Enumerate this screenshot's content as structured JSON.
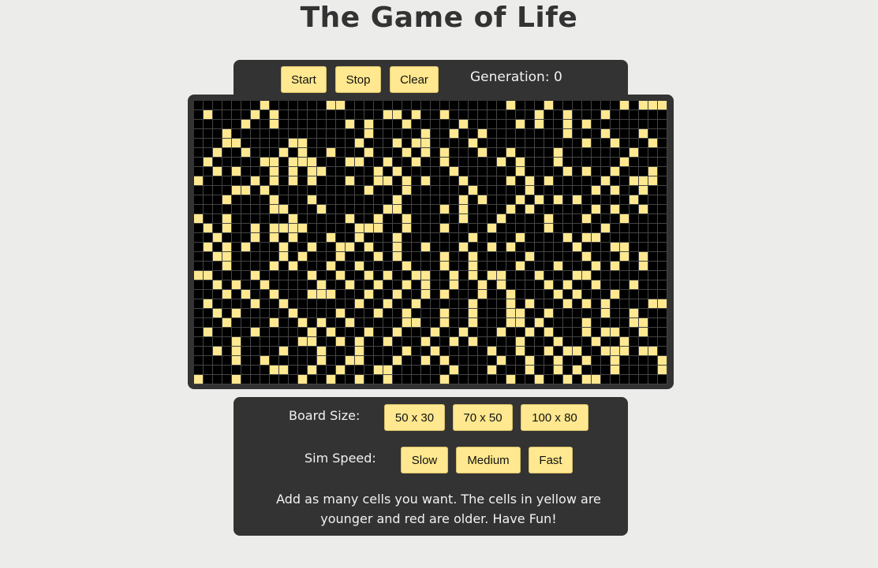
{
  "page": {
    "title": "The Game of Life"
  },
  "controls": {
    "start_label": "Start",
    "stop_label": "Stop",
    "clear_label": "Clear",
    "generation_text": "Generation: 0"
  },
  "board": {
    "columns": 50,
    "rows": 30,
    "alive_color": "#ffe88f",
    "dead_color": "#000000",
    "alive_cells": [
      [
        0,
        7
      ],
      [
        0,
        14
      ],
      [
        0,
        15
      ],
      [
        0,
        33
      ],
      [
        0,
        37
      ],
      [
        0,
        45
      ],
      [
        0,
        47
      ],
      [
        0,
        48
      ],
      [
        0,
        49
      ],
      [
        1,
        1
      ],
      [
        1,
        6
      ],
      [
        1,
        8
      ],
      [
        1,
        20
      ],
      [
        1,
        21
      ],
      [
        1,
        23
      ],
      [
        1,
        26
      ],
      [
        1,
        36
      ],
      [
        1,
        39
      ],
      [
        1,
        43
      ],
      [
        2,
        5
      ],
      [
        2,
        8
      ],
      [
        2,
        16
      ],
      [
        2,
        18
      ],
      [
        2,
        22
      ],
      [
        2,
        28
      ],
      [
        2,
        34
      ],
      [
        2,
        36
      ],
      [
        2,
        39
      ],
      [
        2,
        41
      ],
      [
        3,
        3
      ],
      [
        3,
        18
      ],
      [
        3,
        24
      ],
      [
        3,
        27
      ],
      [
        3,
        30
      ],
      [
        3,
        39
      ],
      [
        3,
        43
      ],
      [
        3,
        47
      ],
      [
        4,
        3
      ],
      [
        4,
        4
      ],
      [
        4,
        10
      ],
      [
        4,
        11
      ],
      [
        4,
        17
      ],
      [
        4,
        21
      ],
      [
        4,
        23
      ],
      [
        4,
        24
      ],
      [
        4,
        29
      ],
      [
        4,
        41
      ],
      [
        4,
        44
      ],
      [
        4,
        48
      ],
      [
        5,
        2
      ],
      [
        5,
        5
      ],
      [
        5,
        9
      ],
      [
        5,
        11
      ],
      [
        5,
        14
      ],
      [
        5,
        18
      ],
      [
        5,
        22
      ],
      [
        5,
        24
      ],
      [
        5,
        26
      ],
      [
        5,
        30
      ],
      [
        5,
        33
      ],
      [
        5,
        38
      ],
      [
        5,
        46
      ],
      [
        6,
        1
      ],
      [
        6,
        7
      ],
      [
        6,
        8
      ],
      [
        6,
        10
      ],
      [
        6,
        11
      ],
      [
        6,
        12
      ],
      [
        6,
        16
      ],
      [
        6,
        17
      ],
      [
        6,
        20
      ],
      [
        6,
        23
      ],
      [
        6,
        26
      ],
      [
        6,
        32
      ],
      [
        6,
        34
      ],
      [
        6,
        38
      ],
      [
        6,
        45
      ],
      [
        7,
        2
      ],
      [
        7,
        4
      ],
      [
        7,
        8
      ],
      [
        7,
        10
      ],
      [
        7,
        12
      ],
      [
        7,
        13
      ],
      [
        7,
        19
      ],
      [
        7,
        21
      ],
      [
        7,
        27
      ],
      [
        7,
        34
      ],
      [
        7,
        39
      ],
      [
        7,
        41
      ],
      [
        7,
        44
      ],
      [
        7,
        48
      ],
      [
        8,
        0
      ],
      [
        8,
        6
      ],
      [
        8,
        8
      ],
      [
        8,
        10
      ],
      [
        8,
        12
      ],
      [
        8,
        16
      ],
      [
        8,
        19
      ],
      [
        8,
        20
      ],
      [
        8,
        22
      ],
      [
        8,
        24
      ],
      [
        8,
        28
      ],
      [
        8,
        33
      ],
      [
        8,
        35
      ],
      [
        8,
        37
      ],
      [
        8,
        43
      ],
      [
        8,
        46
      ],
      [
        8,
        47
      ],
      [
        8,
        48
      ],
      [
        9,
        4
      ],
      [
        9,
        5
      ],
      [
        9,
        7
      ],
      [
        9,
        18
      ],
      [
        9,
        22
      ],
      [
        9,
        29
      ],
      [
        9,
        35
      ],
      [
        9,
        42
      ],
      [
        9,
        44
      ],
      [
        9,
        47
      ],
      [
        10,
        3
      ],
      [
        10,
        8
      ],
      [
        10,
        12
      ],
      [
        10,
        21
      ],
      [
        10,
        28
      ],
      [
        10,
        30
      ],
      [
        10,
        34
      ],
      [
        10,
        36
      ],
      [
        10,
        38
      ],
      [
        10,
        40
      ],
      [
        10,
        46
      ],
      [
        11,
        8
      ],
      [
        11,
        9
      ],
      [
        11,
        13
      ],
      [
        11,
        20
      ],
      [
        11,
        21
      ],
      [
        11,
        26
      ],
      [
        11,
        28
      ],
      [
        11,
        33
      ],
      [
        11,
        35
      ],
      [
        11,
        42
      ],
      [
        11,
        44
      ],
      [
        11,
        47
      ],
      [
        12,
        0
      ],
      [
        12,
        3
      ],
      [
        12,
        10
      ],
      [
        12,
        16
      ],
      [
        12,
        19
      ],
      [
        12,
        22
      ],
      [
        12,
        28
      ],
      [
        12,
        32
      ],
      [
        12,
        37
      ],
      [
        12,
        41
      ],
      [
        12,
        45
      ],
      [
        13,
        1
      ],
      [
        13,
        3
      ],
      [
        13,
        6
      ],
      [
        13,
        8
      ],
      [
        13,
        9
      ],
      [
        13,
        10
      ],
      [
        13,
        11
      ],
      [
        13,
        17
      ],
      [
        13,
        18
      ],
      [
        13,
        19
      ],
      [
        13,
        22
      ],
      [
        13,
        26
      ],
      [
        13,
        31
      ],
      [
        13,
        37
      ],
      [
        13,
        43
      ],
      [
        14,
        2
      ],
      [
        14,
        6
      ],
      [
        14,
        8
      ],
      [
        14,
        10
      ],
      [
        14,
        14
      ],
      [
        14,
        17
      ],
      [
        14,
        21
      ],
      [
        14,
        29
      ],
      [
        14,
        34
      ],
      [
        14,
        39
      ],
      [
        14,
        41
      ],
      [
        14,
        42
      ],
      [
        15,
        1
      ],
      [
        15,
        3
      ],
      [
        15,
        5
      ],
      [
        15,
        9
      ],
      [
        15,
        12
      ],
      [
        15,
        15
      ],
      [
        15,
        16
      ],
      [
        15,
        18
      ],
      [
        15,
        21
      ],
      [
        15,
        24
      ],
      [
        15,
        28
      ],
      [
        15,
        31
      ],
      [
        15,
        33
      ],
      [
        15,
        40
      ],
      [
        15,
        44
      ],
      [
        15,
        45
      ],
      [
        16,
        2
      ],
      [
        16,
        3
      ],
      [
        16,
        9
      ],
      [
        16,
        11
      ],
      [
        16,
        15
      ],
      [
        16,
        19
      ],
      [
        16,
        21
      ],
      [
        16,
        26
      ],
      [
        16,
        29
      ],
      [
        16,
        35
      ],
      [
        16,
        41
      ],
      [
        16,
        45
      ],
      [
        16,
        47
      ],
      [
        17,
        3
      ],
      [
        17,
        8
      ],
      [
        17,
        10
      ],
      [
        17,
        14
      ],
      [
        17,
        17
      ],
      [
        17,
        22
      ],
      [
        17,
        26
      ],
      [
        17,
        29
      ],
      [
        17,
        34
      ],
      [
        17,
        38
      ],
      [
        17,
        42
      ],
      [
        17,
        44
      ],
      [
        17,
        47
      ],
      [
        18,
        0
      ],
      [
        18,
        1
      ],
      [
        18,
        6
      ],
      [
        18,
        12
      ],
      [
        18,
        15
      ],
      [
        18,
        18
      ],
      [
        18,
        20
      ],
      [
        18,
        23
      ],
      [
        18,
        24
      ],
      [
        18,
        27
      ],
      [
        18,
        29
      ],
      [
        18,
        31
      ],
      [
        18,
        32
      ],
      [
        18,
        36
      ],
      [
        18,
        40
      ],
      [
        18,
        41
      ],
      [
        19,
        2
      ],
      [
        19,
        4
      ],
      [
        19,
        7
      ],
      [
        19,
        13
      ],
      [
        19,
        16
      ],
      [
        19,
        19
      ],
      [
        19,
        22
      ],
      [
        19,
        24
      ],
      [
        19,
        27
      ],
      [
        19,
        30
      ],
      [
        19,
        32
      ],
      [
        19,
        37
      ],
      [
        19,
        39
      ],
      [
        19,
        42
      ],
      [
        19,
        46
      ],
      [
        20,
        3
      ],
      [
        20,
        5
      ],
      [
        20,
        8
      ],
      [
        20,
        12
      ],
      [
        20,
        13
      ],
      [
        20,
        14
      ],
      [
        20,
        18
      ],
      [
        20,
        21
      ],
      [
        20,
        24
      ],
      [
        20,
        26
      ],
      [
        20,
        30
      ],
      [
        20,
        33
      ],
      [
        20,
        38
      ],
      [
        20,
        40
      ],
      [
        20,
        44
      ],
      [
        21,
        1
      ],
      [
        21,
        6
      ],
      [
        21,
        9
      ],
      [
        21,
        17
      ],
      [
        21,
        20
      ],
      [
        21,
        23
      ],
      [
        21,
        29
      ],
      [
        21,
        33
      ],
      [
        21,
        35
      ],
      [
        21,
        39
      ],
      [
        21,
        41
      ],
      [
        21,
        43
      ],
      [
        21,
        48
      ],
      [
        21,
        49
      ],
      [
        22,
        2
      ],
      [
        22,
        4
      ],
      [
        22,
        10
      ],
      [
        22,
        15
      ],
      [
        22,
        19
      ],
      [
        22,
        22
      ],
      [
        22,
        26
      ],
      [
        22,
        29
      ],
      [
        22,
        33
      ],
      [
        22,
        34
      ],
      [
        22,
        37
      ],
      [
        22,
        43
      ],
      [
        22,
        46
      ],
      [
        23,
        3
      ],
      [
        23,
        8
      ],
      [
        23,
        11
      ],
      [
        23,
        13
      ],
      [
        23,
        16
      ],
      [
        23,
        22
      ],
      [
        23,
        23
      ],
      [
        23,
        26
      ],
      [
        23,
        29
      ],
      [
        23,
        33
      ],
      [
        23,
        34
      ],
      [
        23,
        36
      ],
      [
        23,
        41
      ],
      [
        23,
        46
      ],
      [
        23,
        47
      ],
      [
        24,
        1
      ],
      [
        24,
        6
      ],
      [
        24,
        12
      ],
      [
        24,
        14
      ],
      [
        24,
        18
      ],
      [
        24,
        21
      ],
      [
        24,
        25
      ],
      [
        24,
        28
      ],
      [
        24,
        32
      ],
      [
        24,
        35
      ],
      [
        24,
        37
      ],
      [
        24,
        41
      ],
      [
        24,
        43
      ],
      [
        24,
        44
      ],
      [
        24,
        47
      ],
      [
        25,
        4
      ],
      [
        25,
        11
      ],
      [
        25,
        12
      ],
      [
        25,
        15
      ],
      [
        25,
        17
      ],
      [
        25,
        20
      ],
      [
        25,
        24
      ],
      [
        25,
        27
      ],
      [
        25,
        29
      ],
      [
        25,
        34
      ],
      [
        25,
        38
      ],
      [
        25,
        42
      ],
      [
        25,
        45
      ],
      [
        26,
        2
      ],
      [
        26,
        4
      ],
      [
        26,
        9
      ],
      [
        26,
        13
      ],
      [
        26,
        17
      ],
      [
        26,
        22
      ],
      [
        26,
        25
      ],
      [
        26,
        31
      ],
      [
        26,
        34
      ],
      [
        26,
        37
      ],
      [
        26,
        39
      ],
      [
        26,
        40
      ],
      [
        26,
        43
      ],
      [
        26,
        44
      ],
      [
        26,
        45
      ],
      [
        26,
        47
      ],
      [
        26,
        48
      ],
      [
        27,
        4
      ],
      [
        27,
        7
      ],
      [
        27,
        13
      ],
      [
        27,
        16
      ],
      [
        27,
        17
      ],
      [
        27,
        21
      ],
      [
        27,
        24
      ],
      [
        27,
        26
      ],
      [
        27,
        32
      ],
      [
        27,
        35
      ],
      [
        27,
        38
      ],
      [
        27,
        41
      ],
      [
        27,
        44
      ],
      [
        27,
        49
      ],
      [
        28,
        8
      ],
      [
        28,
        9
      ],
      [
        28,
        12
      ],
      [
        28,
        15
      ],
      [
        28,
        19
      ],
      [
        28,
        20
      ],
      [
        28,
        27
      ],
      [
        28,
        31
      ],
      [
        28,
        35
      ],
      [
        28,
        38
      ],
      [
        28,
        40
      ],
      [
        28,
        44
      ],
      [
        28,
        49
      ],
      [
        29,
        0
      ],
      [
        29,
        4
      ],
      [
        29,
        11
      ],
      [
        29,
        14
      ],
      [
        29,
        17
      ],
      [
        29,
        20
      ],
      [
        29,
        26
      ],
      [
        29,
        33
      ],
      [
        29,
        36
      ],
      [
        29,
        39
      ],
      [
        29,
        41
      ],
      [
        29,
        42
      ]
    ]
  },
  "settings": {
    "board_size_label": "Board Size:",
    "size_50x30": "50 x 30",
    "size_70x50": "70 x 50",
    "size_100x80": "100 x 80",
    "sim_speed_label": "Sim Speed:",
    "speed_slow": "Slow",
    "speed_medium": "Medium",
    "speed_fast": "Fast",
    "info_text": "Add as many cells you want. The cells in yellow are younger and red are older. Have Fun!"
  }
}
